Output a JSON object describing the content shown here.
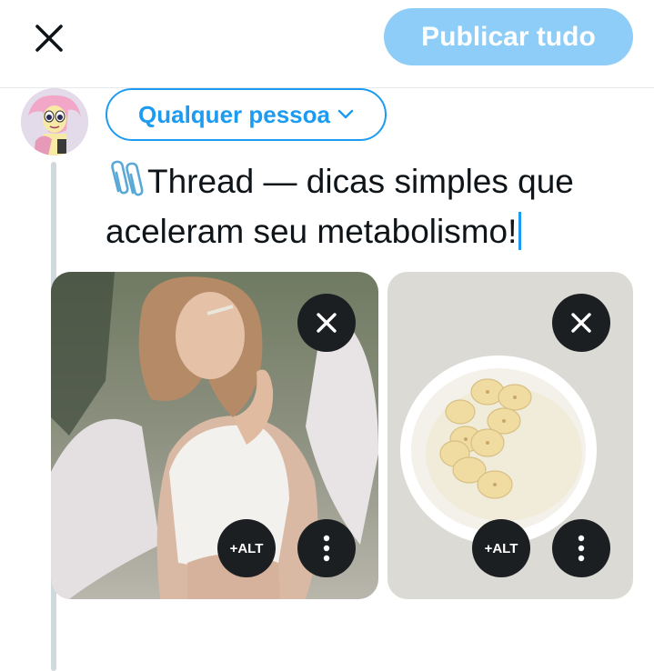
{
  "header": {
    "close_icon": "close-icon",
    "publish_label": "Publicar tudo",
    "publish_color": "#8ecdf7"
  },
  "composer": {
    "avatar": "profile-avatar",
    "audience_label": "Qualquer pessoa",
    "audience_icon": "chevron-down-icon",
    "text_emoji": "paperclips-emoji",
    "text_line1": "Thread — dicas simples que",
    "text_line2": "aceleram seu metabolismo!",
    "accent_color": "#1d9bf0"
  },
  "media": [
    {
      "photo": "woman-with-angel-wings-photo",
      "remove_icon": "close-icon",
      "alt_label": "+ALT",
      "more_icon": "more-vertical-icon"
    },
    {
      "photo": "yogurt-bowl-with-banana-photo",
      "remove_icon": "close-icon",
      "alt_label": "+ALT",
      "more_icon": "more-vertical-icon"
    }
  ]
}
